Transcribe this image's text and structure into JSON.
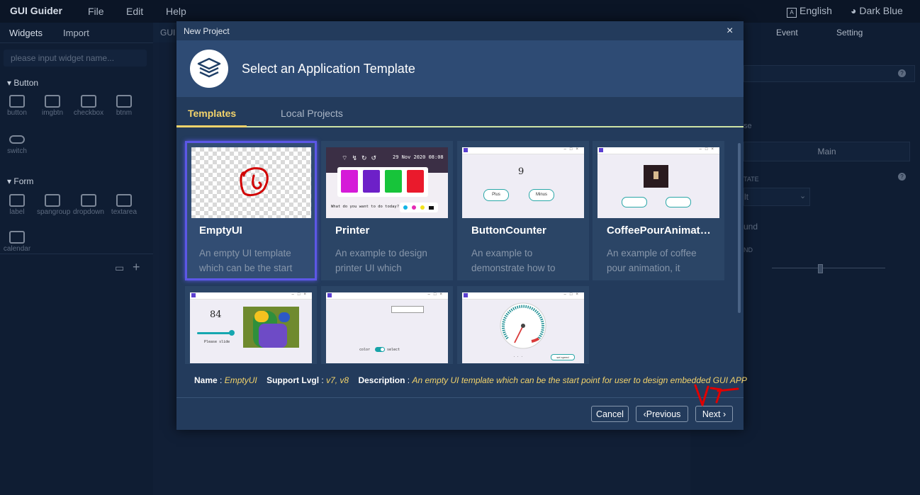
{
  "app": {
    "title": "GUI Guider",
    "menu": [
      "File",
      "Edit",
      "Help"
    ],
    "language": "English",
    "theme": "Dark Blue"
  },
  "left_panel": {
    "tabs": [
      "Widgets",
      "Import"
    ],
    "search_placeholder": "please input widget name...",
    "sections": [
      {
        "title": "Button",
        "items": [
          "button",
          "imgbtn",
          "checkbox",
          "btnm",
          "switch"
        ]
      },
      {
        "title": "Form",
        "items": [
          "label",
          "spangroup",
          "dropdown",
          "textarea",
          "calendar"
        ]
      }
    ]
  },
  "center": {
    "tab": "GUI"
  },
  "right_panel": {
    "tabs": [
      "Event",
      "Setting"
    ],
    "screen_value": "Main",
    "fragments": [
      "se",
      "TATE",
      "lt",
      "und",
      "ND"
    ]
  },
  "dialog": {
    "title": "New Project",
    "close": "×",
    "header": "Select an Application Template",
    "tabs": [
      "Templates",
      "Local Projects"
    ],
    "templates": [
      {
        "name": "EmptyUI",
        "desc": "An empty UI template which can be the start"
      },
      {
        "name": "Printer",
        "desc": "An example to design printer UI which"
      },
      {
        "name": "ButtonCounter",
        "desc": "An example to demonstrate how to"
      },
      {
        "name": "CoffeePourAnimation",
        "desc": "An example of coffee pour animation, it"
      }
    ],
    "thumbs": {
      "printer_date": "29 Nov 2020 08:08",
      "printer_prompt": "What do you want to do today?",
      "counter_value": "9",
      "counter_plus": "Plus",
      "counter_minus": "Minus",
      "slider_value": "84",
      "slider_caption": "Please slide",
      "switch_left": "color",
      "switch_right": "select",
      "gauge_button": "set speed"
    },
    "info": {
      "name_label": "Name",
      "name_value": "EmptyUI",
      "support_label": "Support Lvgl",
      "support_value": "v7, v8",
      "desc_label": "Description",
      "desc_value": "An empty UI template which can be the start point for user to design embedded GUI APP"
    },
    "buttons": {
      "cancel": "Cancel",
      "previous": "Previous",
      "next": "Next"
    }
  },
  "annotation": {
    "text": "V7"
  }
}
